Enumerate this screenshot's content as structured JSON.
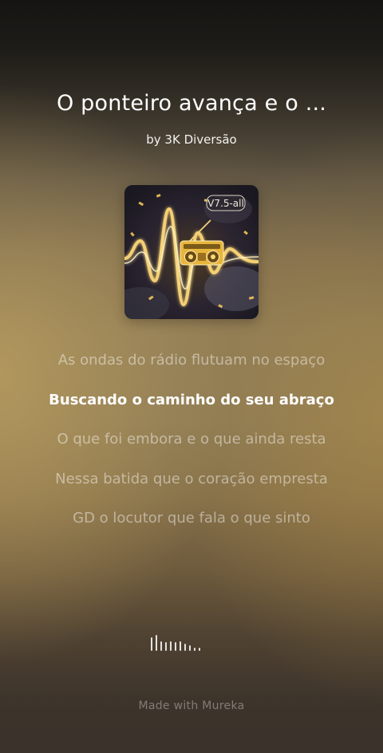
{
  "song": {
    "title": "O ponteiro avança e o ...",
    "artist": "by 3K Diversão"
  },
  "cover": {
    "badge": "V7.5-all",
    "icon": "radio-boombox"
  },
  "lyrics": {
    "lines": [
      "As ondas do rádio flutuam no espaço",
      "Buscando o caminho do seu abraço",
      "O que foi embora e o que ainda resta",
      "Nessa batida que o coração empresta",
      "GD o locutor que fala o que sinto"
    ],
    "active_index": 1
  },
  "player": {
    "visualizer_icon": "audio-wave-icon",
    "bar_levels": [
      0.85,
      1.0,
      0.6,
      0.55,
      0.6,
      0.55,
      0.6,
      0.45,
      0.35,
      0.2,
      0.2
    ]
  },
  "footer": {
    "text": "Made with Mureka"
  },
  "colors": {
    "text_primary": "#ffffff",
    "text_dim": "rgba(255,255,255,0.45)",
    "gold_accent": "#f5c94a"
  }
}
